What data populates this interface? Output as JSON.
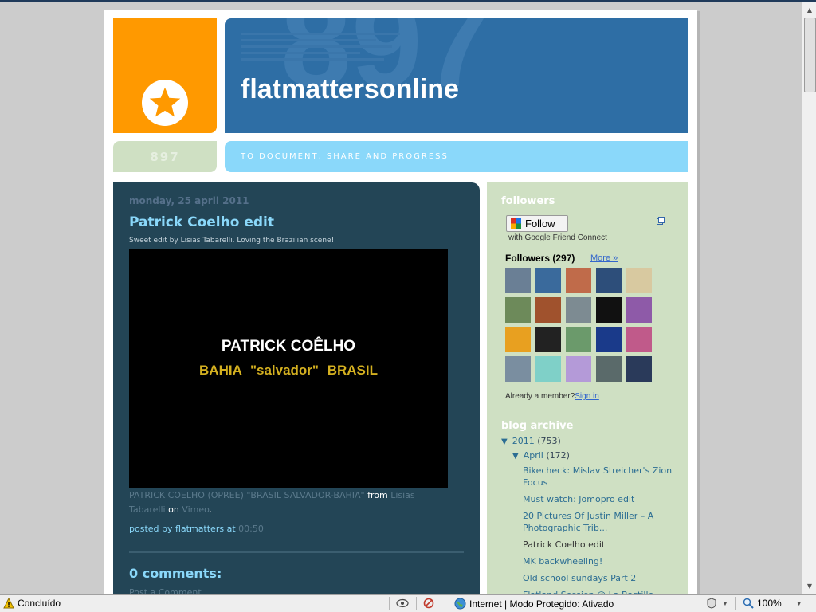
{
  "blog": {
    "title": "flatmattersonline",
    "header_number": "897",
    "header_bg_number": "897",
    "tagline": "TO DOCUMENT, SHARE AND PROGRESS"
  },
  "post": {
    "date": "monday, 25 april 2011",
    "title": "Patrick Coelho edit",
    "intro": "Sweet edit by Lisias Tabarelli. Loving the Brazilian scene!",
    "video_line1": "PATRICK COÊLHO",
    "video_line2": "BAHIA \"salvador\" BRASIL",
    "caption_link": "PATRICK COELHO (OPREE) \"BRASIL SALVADOR-BAHIA\"",
    "caption_from": "from",
    "caption_author_1": "Lisias",
    "caption_author_2": "Tabarelli",
    "caption_on": "on",
    "caption_site": "Vimeo",
    "caption_end": ".",
    "posted_by_label": "posted by flatmatters at",
    "posted_time": "00:50",
    "comments_heading": "0 comments:",
    "post_comment": "Post a Comment"
  },
  "sidebar": {
    "followers_heading": "followers",
    "follow_button": "Follow",
    "gfc_text": "with Google Friend Connect",
    "followers_count": "Followers (297)",
    "more_link": "More »",
    "already_member": "Already a member?",
    "sign_in": "Sign in",
    "archive_heading": "blog archive",
    "archive_year": "2011",
    "archive_year_count": "(753)",
    "archive_month": "April",
    "archive_month_count": "(172)",
    "archive_items": [
      "Bikecheck: Mislav Streicher's Zion Focus",
      "Must watch: Jomopro edit",
      "20 Pictures Of Justin Miller – A Photographic Trib...",
      "Patrick Coelho edit",
      "MK backwheeling!",
      "Old school sundays Part 2",
      "Flatland Session @ La Bastille"
    ]
  },
  "avatars": [
    "#6a7f95",
    "#3a6a9c",
    "#c06b4a",
    "#2d4e7a",
    "#d8c9a0",
    "#6d8a5a",
    "#a0522d",
    "#7d8b92",
    "#111111",
    "#8e5aa8",
    "#e8a020",
    "#222222",
    "#6b9a6b",
    "#1a3a8a",
    "#c05a8a",
    "#7a8ea0",
    "#7fd0c8",
    "#b49ad8",
    "#5a6a6a",
    "#2a3a5a"
  ],
  "statusbar": {
    "status": "Concluído",
    "zone": "Internet | Modo Protegido: Ativado",
    "zoom": "100%"
  },
  "colors": {
    "orange": "#ff9900",
    "header_blue": "#2e6ea5",
    "light_blue": "#8ad8fa",
    "main_bg": "#234556",
    "sidebar_bg": "#cfe0c3"
  }
}
